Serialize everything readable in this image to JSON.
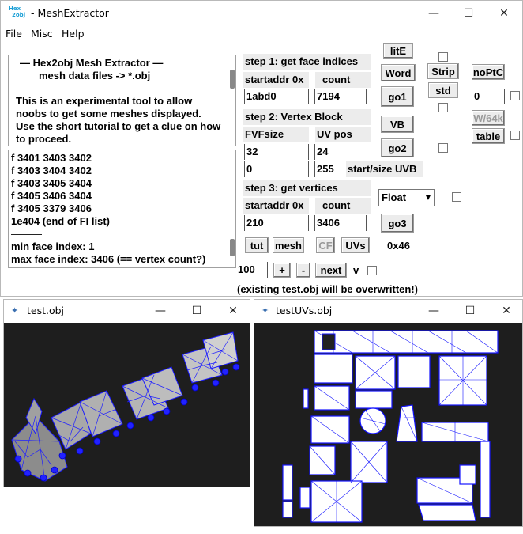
{
  "main": {
    "title": "- MeshExtractor",
    "logo_text": "Hex2obj",
    "menu": [
      "File",
      "Misc",
      "Help"
    ],
    "intro": {
      "heading": "—  Hex2obj Mesh Extractor  —",
      "subheading": "mesh data files -> *.obj",
      "body": "This is an experimental tool to allow noobs to get some meshes displayed. Use the short tutorial to get a clue on how to proceed."
    },
    "log_lines": [
      "f  3401 3403 3402",
      "f  3403 3404 3402",
      "f  3403 3405 3404",
      "f  3405 3406 3404",
      "f  3405 3379 3406",
      "1e404 (end of FI list)",
      "———",
      "min face index: 1",
      "max face index: 3406 (== vertex count?)"
    ],
    "step1": {
      "title": "step 1: get face indices",
      "startaddr_label": "startaddr 0x",
      "count_label": "count",
      "startaddr": "1abd0",
      "count": "7194",
      "go_label": "go1"
    },
    "step2": {
      "title": "step 2: Vertex Block",
      "fvf_label": "FVFsize",
      "uvpos_label": "UV pos",
      "fvf": "32",
      "uvpos": "24",
      "start": "0",
      "size": "255",
      "uvb_label": "start/size UVB",
      "vb_label": "VB",
      "go_label": "go2"
    },
    "step3": {
      "title": "step 3: get vertices",
      "startaddr_label": "startaddr 0x",
      "count_label": "count",
      "startaddr": "210",
      "count": "3406",
      "format": "Float",
      "go_label": "go3"
    },
    "side_buttons": {
      "lite": "litE",
      "word": "Word",
      "strip": "Strip",
      "std": "std",
      "noptc": "noPtC",
      "w64": "W/64k",
      "table": "table",
      "field_value": "0"
    },
    "bottom": {
      "tut": "tut",
      "mesh": "mesh",
      "cf": "CF",
      "uvs": "UVs",
      "hex": "0x46",
      "zoom": "100",
      "plus": "+",
      "minus": "-",
      "next": "next",
      "v": "v",
      "warning": "(existing test.obj will be overwritten!)"
    }
  },
  "test_window": {
    "title": "test.obj"
  },
  "uv_window": {
    "title": "testUVs.obj"
  },
  "colors": {
    "wire": "#1010ff",
    "viewport_bg": "#1e1e1e"
  }
}
